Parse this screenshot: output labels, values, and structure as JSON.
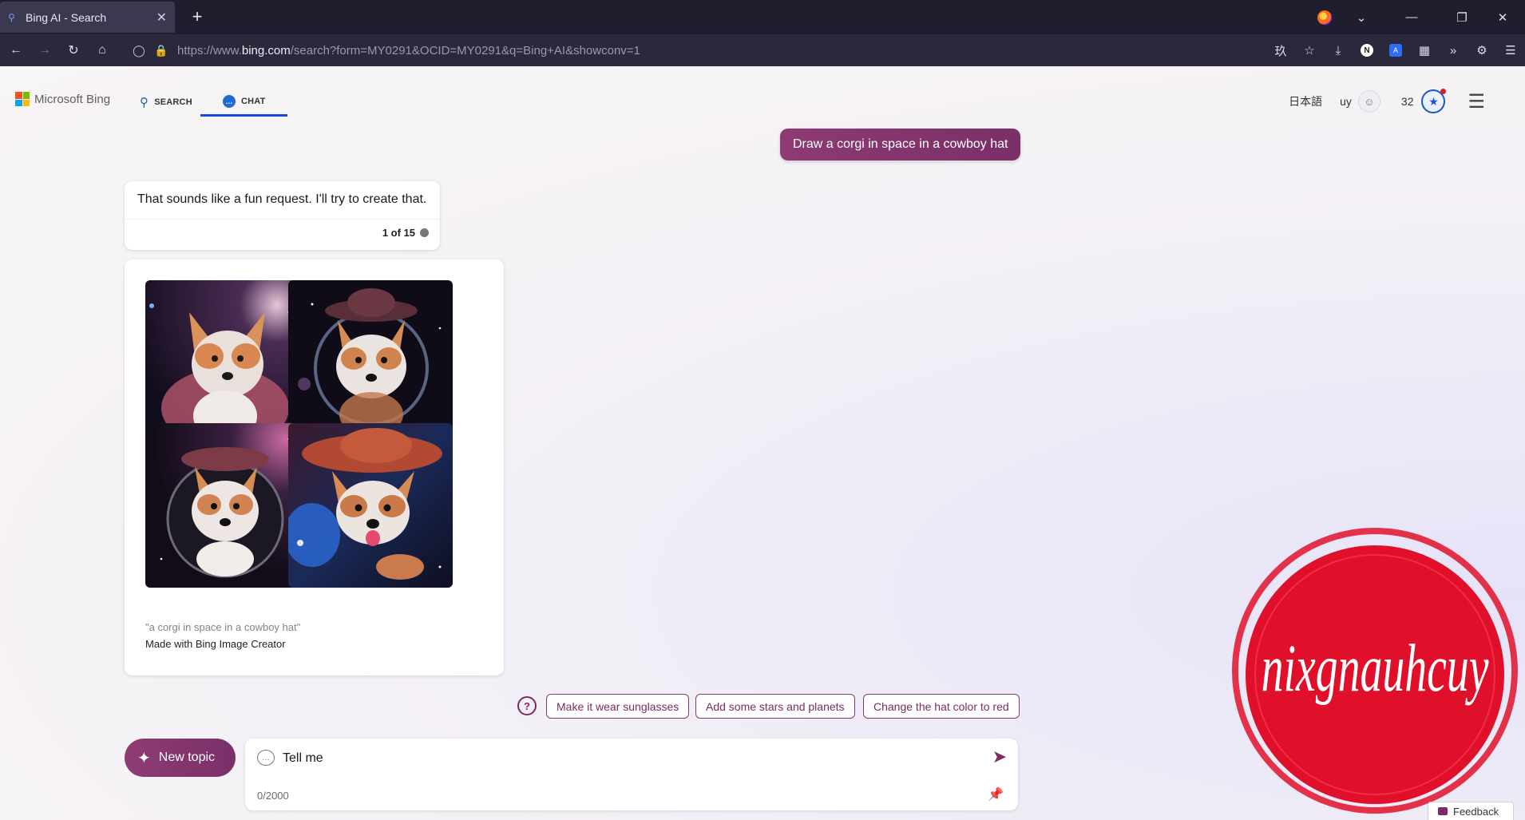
{
  "browser": {
    "tab_title": "Bing AI - Search",
    "url_prefix": "https://www.",
    "url_domain": "bing.com",
    "url_rest": "/search?form=MY0291&OCID=MY0291&q=Bing+AI&showconv=1"
  },
  "header": {
    "brand": "Microsoft Bing",
    "tabs": [
      {
        "label": "SEARCH",
        "icon": "search-icon",
        "active": false
      },
      {
        "label": "CHAT",
        "icon": "chat-icon",
        "active": true
      }
    ],
    "language": "日本語",
    "user_initials": "uy",
    "rewards_points": "32"
  },
  "chat": {
    "user_message": "Draw a corgi in space in a cowboy hat",
    "bot_message": "That sounds like a fun request. I'll try to create that.",
    "turn_counter": "1 of 15",
    "image_caption": "\"a corgi in space in a cowboy hat\"",
    "image_credit": "Made with Bing Image Creator"
  },
  "suggestions": [
    "Make it wear sunglasses",
    "Add some stars and planets",
    "Change the hat color to red"
  ],
  "composer": {
    "new_topic_label": "New topic",
    "input_value": "Tell me",
    "char_counter": "0/2000"
  },
  "watermark_text": "nixgnauhcuy",
  "feedback_label": "Feedback",
  "colors": {
    "accent": "#7d2b62",
    "active_tab_underline": "#174ae4",
    "watermark_red": "#e0102a"
  }
}
